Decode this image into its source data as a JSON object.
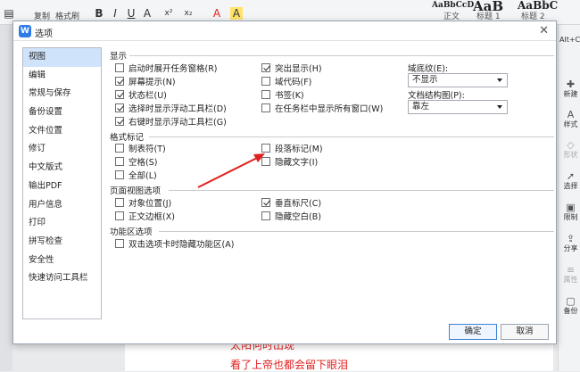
{
  "app": {
    "toolbar": {
      "copy_label": "复制",
      "format_painter_label": "格式刷",
      "format_buttons": [
        "B",
        "I",
        "U",
        "A",
        "x²",
        "x₂",
        "A",
        "A"
      ],
      "styles": [
        {
          "preview": "AaBbCcD",
          "name": "正文"
        },
        {
          "preview": "AaB",
          "name": "标题 1"
        },
        {
          "preview": "AaBbC",
          "name": "标题 2"
        }
      ]
    },
    "right_edge_text": "Alt+C",
    "right_panel": [
      {
        "icon": "new-icon",
        "label": "新建",
        "enabled": true
      },
      {
        "icon": "style-icon",
        "label": "样式",
        "enabled": true
      },
      {
        "icon": "shape-icon",
        "label": "形状",
        "enabled": false
      },
      {
        "icon": "select-icon",
        "label": "选择",
        "enabled": true
      },
      {
        "icon": "limit-icon",
        "label": "限制",
        "enabled": true
      },
      {
        "icon": "share-icon",
        "label": "分享",
        "enabled": true
      },
      {
        "icon": "property-icon",
        "label": "属性",
        "enabled": false
      },
      {
        "icon": "backup-icon",
        "label": "备份",
        "enabled": true
      }
    ],
    "document_lines": [
      "太阳何时出现",
      "看了上帝也都会留下眼泪"
    ]
  },
  "dialog": {
    "title": "选项",
    "logo_letter": "W",
    "nav": [
      "视图",
      "编辑",
      "常规与保存",
      "备份设置",
      "文件位置",
      "修订",
      "中文版式",
      "输出PDF",
      "用户信息",
      "打印",
      "拼写检查",
      "安全性",
      "快速访问工具栏"
    ],
    "active_nav_index": 0,
    "sections": {
      "display": {
        "title": "显示",
        "left": [
          {
            "label": "启动时展开任务窗格(R)",
            "checked": false
          },
          {
            "label": "屏幕提示(N)",
            "checked": true
          },
          {
            "label": "状态栏(U)",
            "checked": true
          },
          {
            "label": "选择时显示浮动工具栏(D)",
            "checked": true
          },
          {
            "label": "右键时显示浮动工具栏(G)",
            "checked": true
          }
        ],
        "middle": [
          {
            "label": "突出显示(H)",
            "checked": true
          },
          {
            "label": "域代码(F)",
            "checked": false
          },
          {
            "label": "书签(K)",
            "checked": false
          },
          {
            "label": "在任务栏中显示所有窗口(W)",
            "checked": false
          }
        ],
        "field_shading_label": "域底纹(E):",
        "field_shading_value": "不显示",
        "doc_structure_label": "文档结构图(P):",
        "doc_structure_value": "靠左"
      },
      "format_marks": {
        "title": "格式标记",
        "left": [
          {
            "label": "制表符(T)",
            "checked": false
          },
          {
            "label": "空格(S)",
            "checked": false
          },
          {
            "label": "全部(L)",
            "checked": false
          }
        ],
        "middle": [
          {
            "label": "段落标记(M)",
            "checked": false
          },
          {
            "label": "隐藏文字(I)",
            "checked": false
          }
        ]
      },
      "page_view": {
        "title": "页面视图选项",
        "left": [
          {
            "label": "对象位置(J)",
            "checked": false
          },
          {
            "label": "正文边框(X)",
            "checked": false
          }
        ],
        "middle": [
          {
            "label": "垂直标尺(C)",
            "checked": true
          },
          {
            "label": "隐藏空白(B)",
            "checked": false
          }
        ]
      },
      "ribbon": {
        "title": "功能区选项",
        "left": [
          {
            "label": "双击选项卡时隐藏功能区(A)",
            "checked": false
          }
        ]
      }
    },
    "ok_label": "确定",
    "cancel_label": "取消",
    "annotation_arrow_color": "#e02020"
  }
}
